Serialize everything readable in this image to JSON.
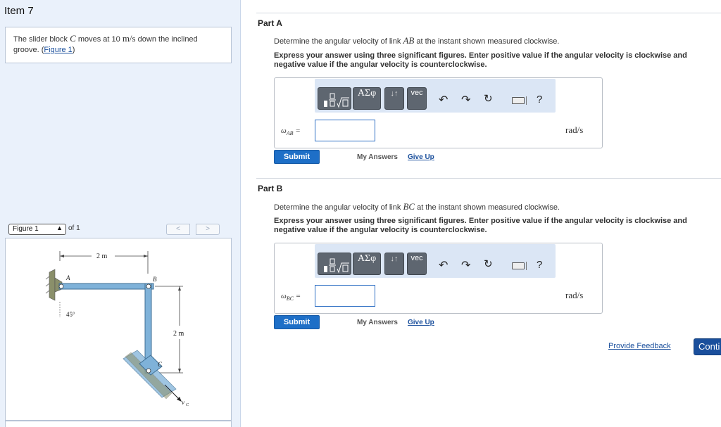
{
  "item": {
    "title": "Item 7"
  },
  "problem": {
    "text_before": "The slider block ",
    "var_c": "C",
    "text_mid": " moves at 10 ",
    "unit": "m/s",
    "text_after": " down the inclined groove. (",
    "figure_link": "Figure 1",
    "close": ")"
  },
  "figure": {
    "selector": "Figure 1",
    "of_text": "of 1",
    "prev": "<",
    "next": ">",
    "labels": {
      "dim_top": "2 m",
      "dim_side": "2 m",
      "a": "A",
      "b": "B",
      "c": "C",
      "angle": "45°",
      "vc": "v",
      "vc_sub": "C"
    }
  },
  "colors": {
    "link_fill": "#7fb2d9",
    "link_stroke": "#3f6f94",
    "submit": "#1e6fc7",
    "accent_link": "#1a4f9c"
  },
  "parts": [
    {
      "title": "Part A",
      "q_before": "Determine the angular velocity of link ",
      "q_var": "AB",
      "q_after": " at the instant shown measured clockwise.",
      "instruction": "Express your answer using three significant figures. Enter positive value if the angular velocity is clockwise and negative value if the angular velocity is counterclockwise.",
      "var_label": "ω",
      "var_sub": "AB",
      "equals": "=",
      "value": "",
      "unit": "rad/s",
      "submit": "Submit",
      "my_answers": "My Answers",
      "give_up": "Give Up"
    },
    {
      "title": "Part B",
      "q_before": "Determine the angular velocity of link ",
      "q_var": "BC",
      "q_after": " at the instant shown measured clockwise.",
      "instruction": "Express your answer using three significant figures. Enter positive value if the angular velocity is clockwise and negative value if the angular velocity is counterclockwise.",
      "var_label": "ω",
      "var_sub": "BC",
      "equals": "=",
      "value": "",
      "unit": "rad/s",
      "submit": "Submit",
      "my_answers": "My Answers",
      "give_up": "Give Up"
    }
  ],
  "toolbar": {
    "greek": "ΑΣφ",
    "arrows": "↓↑",
    "vec": "vec",
    "undo_icon": "undo-icon",
    "redo_icon": "redo-icon",
    "reset_icon": "reset-icon",
    "keyboard_icon": "keyboard-icon",
    "help": "?"
  },
  "footer": {
    "feedback": "Provide Feedback",
    "continue": "Conti"
  }
}
